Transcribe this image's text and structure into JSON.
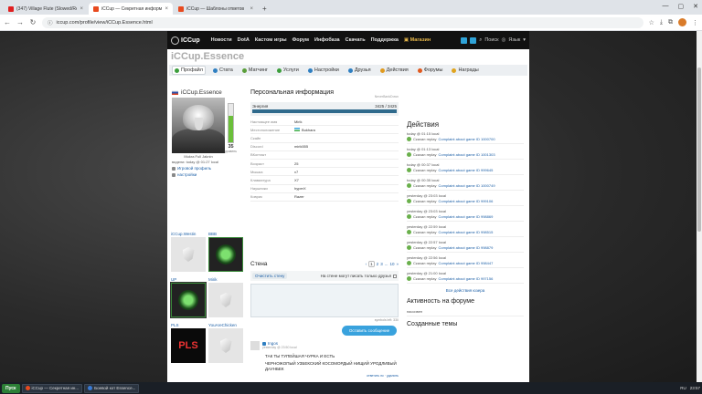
{
  "browser": {
    "tabs": [
      {
        "title": "(347) Village Flute (Slowed/Re",
        "fav_color": "#e02020",
        "active": false
      },
      {
        "title": "iCCup — Секретная информация",
        "fav_color": "#e84a1f",
        "active": true
      },
      {
        "title": "iCCup — Шаблоны ответов",
        "fav_color": "#e84a1f",
        "active": false
      }
    ],
    "url": "iccup.com/profile/view/iCCup.Essence.html"
  },
  "site_nav": {
    "logo": "ICCup",
    "links": [
      "Новости",
      "DotA",
      "Кастом игры",
      "Форум",
      "Инфобаза",
      "Скачать",
      "Поддержка"
    ],
    "shop": "Магазин",
    "search": "Поиск",
    "language": "Язык"
  },
  "profile": {
    "title": "iCCup.Essence",
    "subtabs": [
      {
        "label": "Профайл",
        "color": "#3c9e3c"
      },
      {
        "label": "Стата",
        "color": "#2f7fc1"
      },
      {
        "label": "Матчинг",
        "color": "#5a9e3a"
      },
      {
        "label": "Услуги",
        "color": "#3c9e3c"
      },
      {
        "label": "Настройки",
        "color": "#2f7fc1"
      },
      {
        "label": "Друзья",
        "color": "#2f7fc1"
      },
      {
        "label": "Действия",
        "color": "#e09a1f"
      },
      {
        "label": "Форумы",
        "color": "#e05a1f"
      },
      {
        "label": "Награды",
        "color": "#e0a41f"
      }
    ],
    "name": "iCCup.Essence",
    "nickname_line": "Mukra Full Jaknin",
    "seen": "видели: today @ 01:27 local",
    "level": "35",
    "level_label": "уровень",
    "level_fraction": 0.7,
    "links": [
      "Игровой профиль",
      "настройки"
    ]
  },
  "friends": [
    {
      "name": "iCCup.Westin",
      "pic": "shield"
    },
    {
      "name": "BBB",
      "pic": "dark"
    },
    {
      "name": "UP",
      "pic": "dark-sel"
    },
    {
      "name": "Mirik",
      "pic": "shield"
    },
    {
      "name": "PLS",
      "pic": "red",
      "text": "PLS"
    },
    {
      "name": "YouAreChicken",
      "pic": "shield"
    }
  ],
  "info": {
    "heading": "Персональная информация",
    "never_banned": "NeverBankDown",
    "energy_label": "Энергия",
    "energy_value": "3425 / 3425",
    "energy_fraction": 1.0,
    "rows": [
      {
        "k": "Настоящее имя",
        "v": "Mirik"
      },
      {
        "k": "Местоположение",
        "v": "Bukhara",
        "flag": true
      },
      {
        "k": "Скайп",
        "v": ""
      },
      {
        "k": "Discord",
        "v": "mirik555"
      },
      {
        "k": "ВКонтакт",
        "v": ""
      },
      {
        "k": "Возраст",
        "v": "25"
      },
      {
        "k": "Мышка",
        "v": "x7"
      },
      {
        "k": "Клавиатура",
        "v": "X7"
      },
      {
        "k": "Наушники",
        "v": "hyperX"
      },
      {
        "k": "Коврик",
        "v": "Razer"
      }
    ]
  },
  "wall": {
    "heading": "Стена",
    "pages": [
      "1",
      "2",
      "3",
      "...",
      "10",
      "»"
    ],
    "clear": "Очистить стену",
    "only_friends": "На стене могут писать только друзья",
    "symbols_left": "symbols left: 330",
    "leave_button": "Оставить сообщение",
    "post": {
      "author": "Ingos",
      "time": "yesterday @ 23:50 local",
      "text1": "ТАК ТЫ ТУПЕЙШАЯ ЧУРКА И ЕСТЬ",
      "text2": "ЧЕРНОЖОПЫЙ УЗБЕКСКИЙ КОСОМОРДЫЙ НИЩИЙ УРОДЛИВЫЙ ДАУНБЕК",
      "actions": "ответить пс · удалить"
    }
  },
  "actions": {
    "heading": "Действия",
    "items": [
      {
        "ts": "today @ 01:15 local",
        "prefix": "Скачал replay",
        "link": "Complaint about game ID 1000700"
      },
      {
        "ts": "today @ 01:13 local",
        "prefix": "Скачал replay",
        "link": "Complaint about game ID 1001303"
      },
      {
        "ts": "today @ 00:37 local",
        "prefix": "Скачал replay",
        "link": "Complaint about game ID 999645"
      },
      {
        "ts": "today @ 00:35 local",
        "prefix": "Скачал replay",
        "link": "Complaint about game ID 1000749"
      },
      {
        "ts": "yesterday @ 23:03 local",
        "prefix": "Скачал replay",
        "link": "Complaint about game ID 999106"
      },
      {
        "ts": "yesterday @ 23:03 local",
        "prefix": "Скачал replay",
        "link": "Complaint about game ID 998869"
      },
      {
        "ts": "yesterday @ 22:59 local",
        "prefix": "Скачал replay",
        "link": "Complaint about game ID 998515"
      },
      {
        "ts": "yesterday @ 22:57 local",
        "prefix": "Скачал replay",
        "link": "Complaint about game ID 998879"
      },
      {
        "ts": "yesterday @ 22:56 local",
        "prefix": "Скачал replay",
        "link": "Complaint about game ID 998447"
      },
      {
        "ts": "yesterday @ 21:00 local",
        "prefix": "Скачал replay",
        "link": "Complaint about game ID 997156"
      }
    ],
    "all_events": "Все действия юзера",
    "forum_heading": "Активность на форуме",
    "forum_item": "пассивен",
    "themes_heading": "Созданные темы"
  },
  "taskbar": {
    "start": "Пуск",
    "tasks": [
      {
        "label": "iCCup — Секретная ин...",
        "color": "#e84a1f"
      },
      {
        "label": "Боевой кот Essence...",
        "color": "#3a7bd5"
      }
    ],
    "tray": "RU",
    "clock": "23:57"
  }
}
